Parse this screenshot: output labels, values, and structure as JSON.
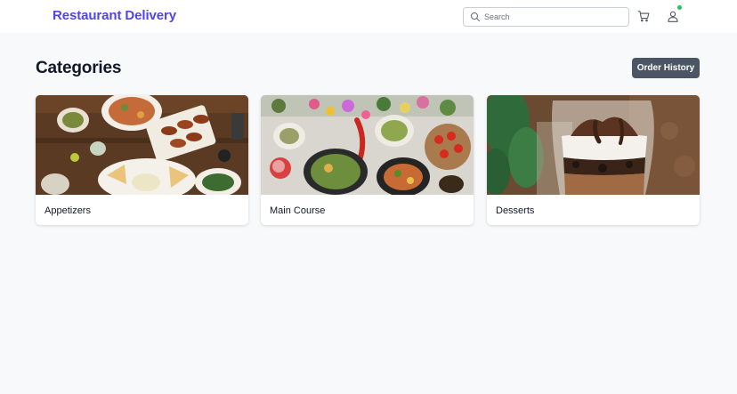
{
  "header": {
    "brand": "Restaurant Delivery",
    "search_placeholder": "Search",
    "icons": {
      "search": "search-icon",
      "cart": "cart-icon",
      "user": "user-icon"
    },
    "notification_dot": true
  },
  "main": {
    "title": "Categories",
    "order_history_label": "Order History",
    "categories": [
      {
        "label": "Appetizers",
        "image": "appetizers-photo"
      },
      {
        "label": "Main Course",
        "image": "main-course-photo"
      },
      {
        "label": "Desserts",
        "image": "desserts-photo"
      }
    ]
  },
  "colors": {
    "brand": "#4f46e5",
    "page_background": "#f8f9fb",
    "button": "#4b5563",
    "status_dot": "#22c55e"
  }
}
